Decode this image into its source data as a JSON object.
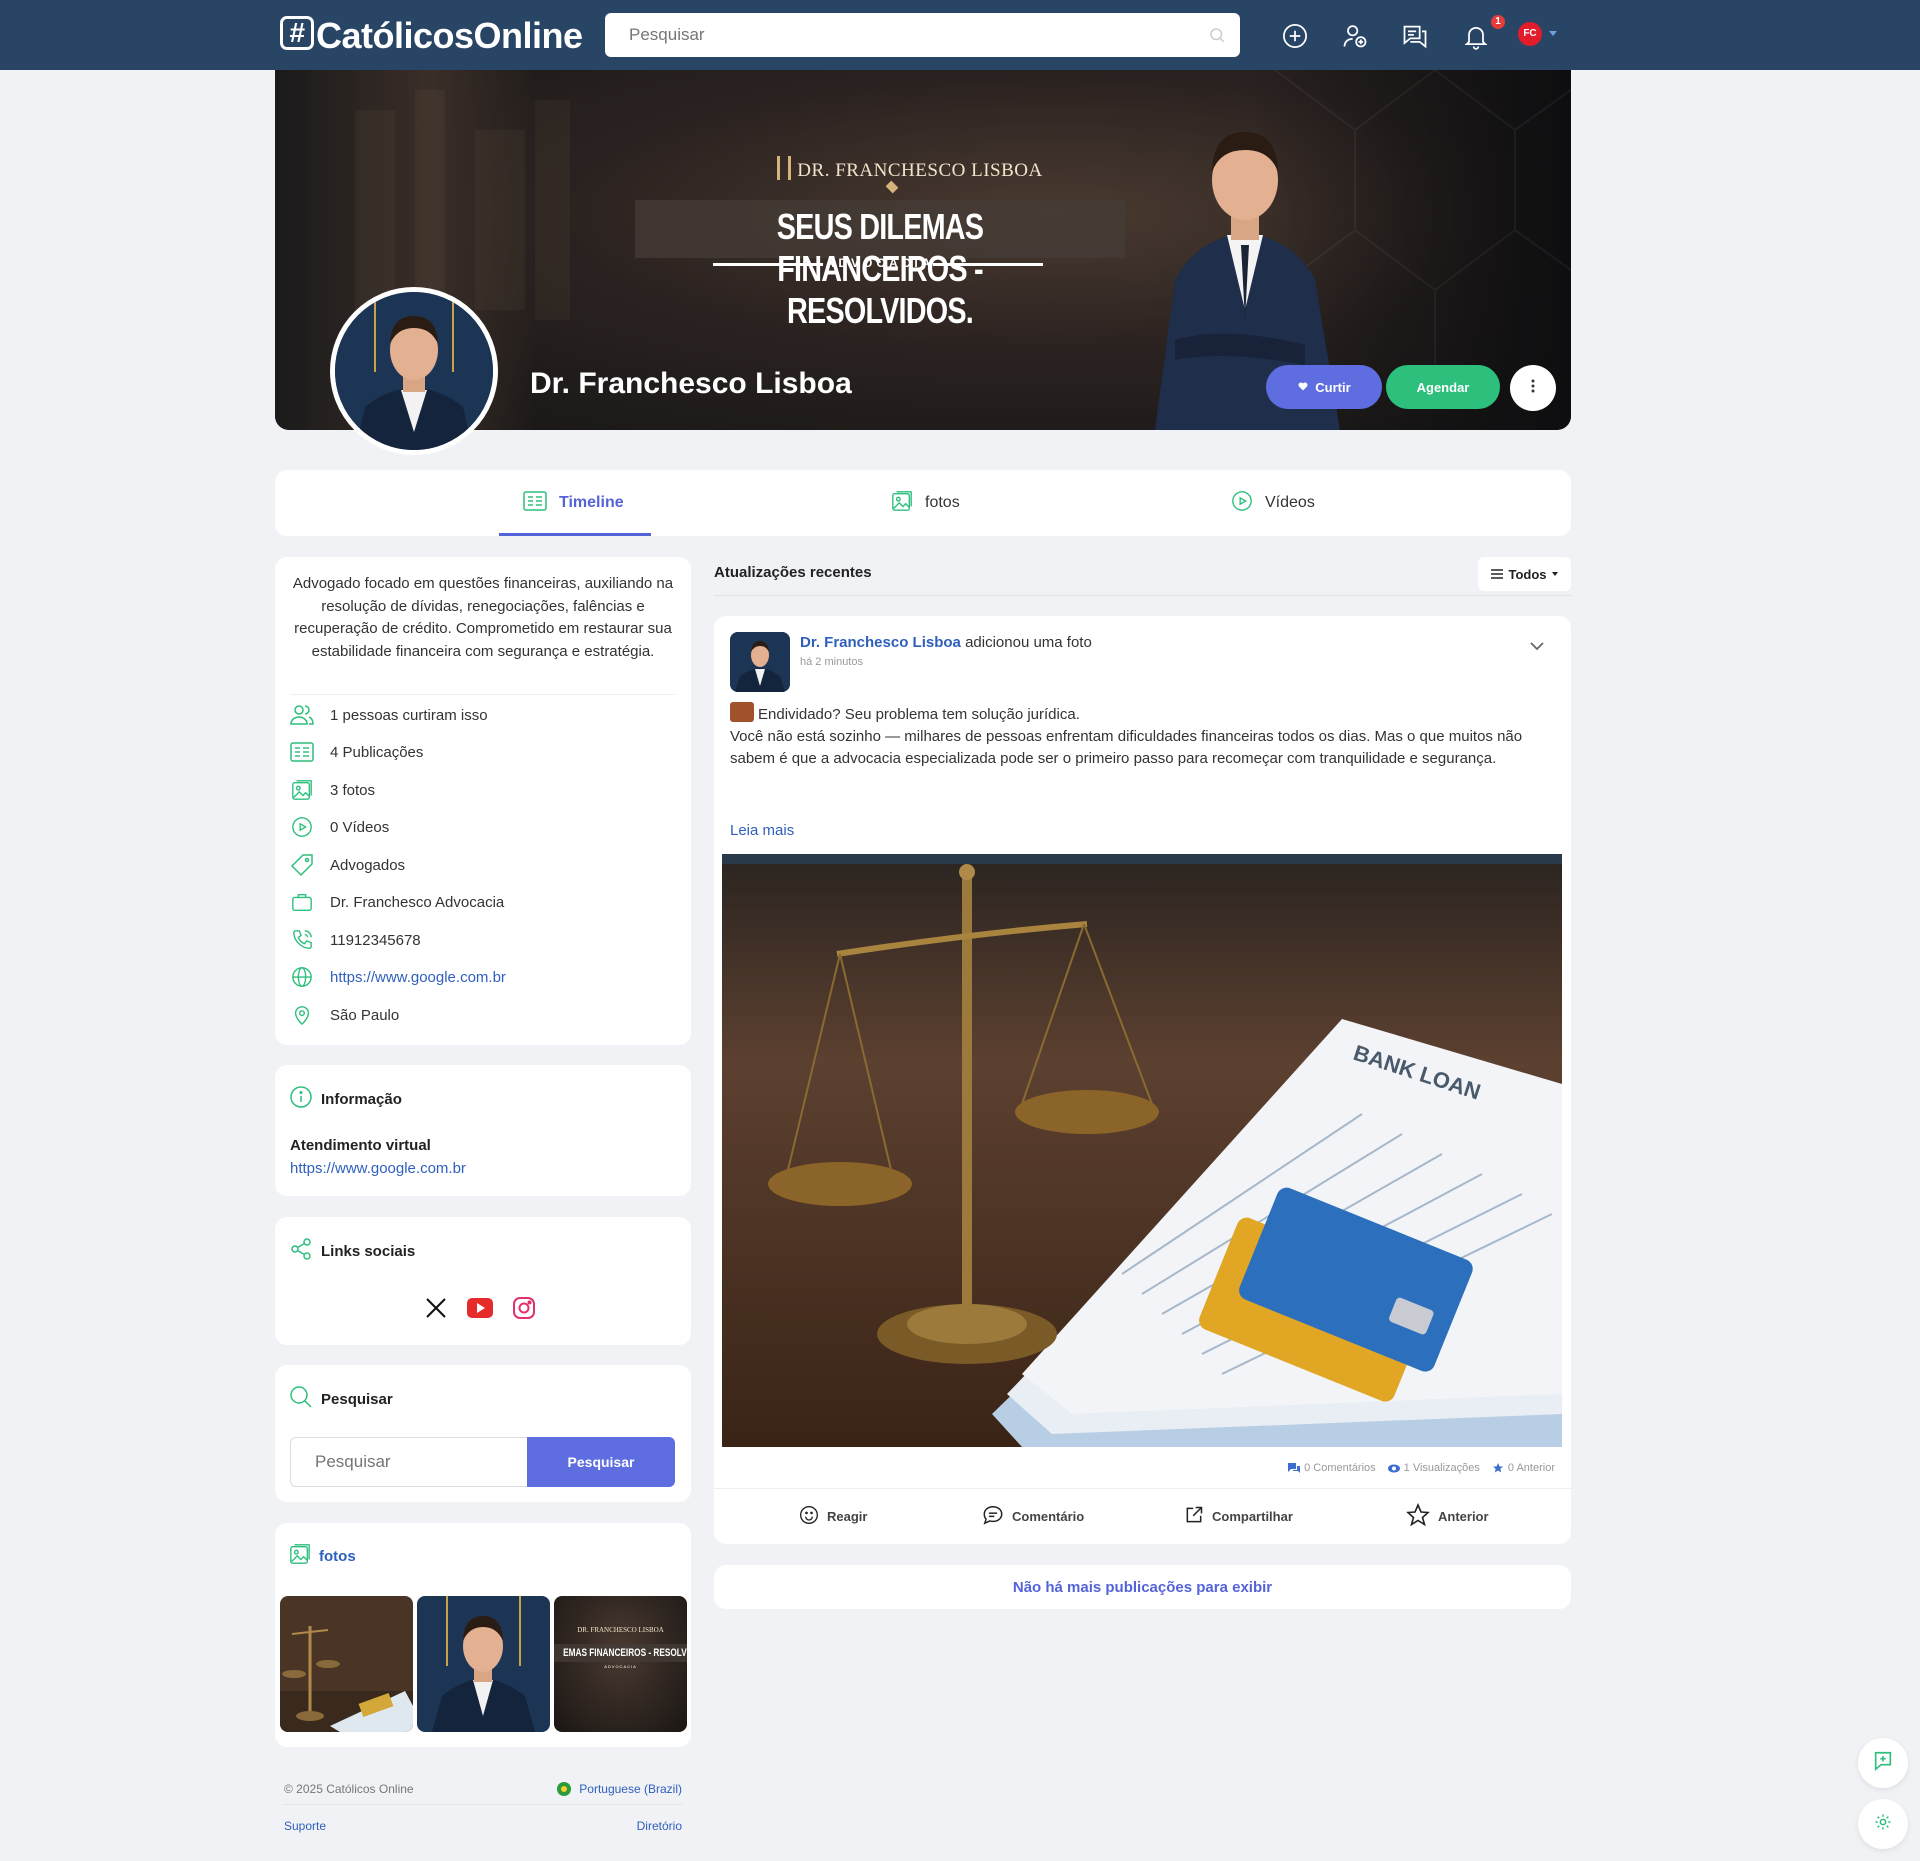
{
  "app": {
    "logo_text": "CatólicosOnline",
    "logo_hash": "#",
    "colors": {
      "topbar": "#294565",
      "accent": "#5e6de0",
      "green": "#2dbf7c",
      "link": "#2f5fbd"
    }
  },
  "header": {
    "search_placeholder": "Pesquisar",
    "notification_count": "1",
    "user_initials": "FC",
    "icons": [
      "search-icon",
      "add-circle-icon",
      "user-add-icon",
      "messages-icon",
      "bell-icon",
      "avatar",
      "chevron-down-icon"
    ]
  },
  "cover": {
    "brand": "DR. FRANCHESCO LISBOA",
    "headline": "SEUS DILEMAS FINANCEIROS - RESOLVIDOS.",
    "subline": "ADVOCACIA"
  },
  "profile": {
    "name": "Dr. Franchesco Lisboa",
    "like_label": "Curtir",
    "schedule_label": "Agendar"
  },
  "tabs": [
    {
      "label": "Timeline",
      "icon": "timeline-icon",
      "active": true
    },
    {
      "label": "fotos",
      "icon": "photos-icon",
      "active": false
    },
    {
      "label": "Vídeos",
      "icon": "video-icon",
      "active": false
    }
  ],
  "about": {
    "description": "Advogado focado em questões financeiras, auxiliando na resolução de dívidas, renegociações, falências e recuperação de crédito. Comprometido em restaurar sua estabilidade financeira com segurança e estratégia.",
    "rows": [
      {
        "icon": "users-icon",
        "text": "1 pessoas curtiram isso"
      },
      {
        "icon": "posts-icon",
        "text": "4 Publicações"
      },
      {
        "icon": "photos-icon",
        "text": "3 fotos"
      },
      {
        "icon": "video-icon",
        "text": "0 Vídeos"
      },
      {
        "icon": "tag-icon",
        "text": "Advogados"
      },
      {
        "icon": "briefcase-icon",
        "text": "Dr. Franchesco Advocacia"
      },
      {
        "icon": "phone-icon",
        "text": "11912345678"
      },
      {
        "icon": "globe-icon",
        "text": "https://www.google.com.br"
      },
      {
        "icon": "location-icon",
        "text": "São Paulo"
      }
    ]
  },
  "information": {
    "title": "Informação",
    "label": "Atendimento virtual",
    "link": "https://www.google.com.br"
  },
  "social": {
    "title": "Links sociais",
    "icons": [
      "x-icon",
      "youtube-icon",
      "instagram-icon"
    ]
  },
  "page_search": {
    "title": "Pesquisar",
    "placeholder": "Pesquisar",
    "button": "Pesquisar"
  },
  "photos": {
    "title": "fotos",
    "thumb_caption_brand": "DR. FRANCHESCO LISBOA",
    "thumb_caption_headline": "EMAS FINANCEIROS - RESOLVIDOS",
    "thumb_caption_sub": "ADVOCACIA"
  },
  "footer": {
    "copyright": "© 2025 Católicos Online",
    "language": "Portuguese (Brazil)",
    "support": "Suporte",
    "directory": "Diretório"
  },
  "feed": {
    "title": "Atualizações recentes",
    "filter": "Todos",
    "no_more": "Não há mais publicações para exibir"
  },
  "post": {
    "author": "Dr. Franchesco Lisboa",
    "action": "adicionou uma foto",
    "time": "há 2 minutos",
    "headline": "Endividado? Seu problema tem solução jurídica.",
    "body": "Você não está sozinho — milhares de pessoas enfrentam dificuldades financeiras todos os dias. Mas o que muitos não sabem é que a advocacia especializada pode ser o primeiro passo para recomeçar com tranquilidade e segurança.",
    "read_more": "Leia mais",
    "image_text": "BANK LOAN",
    "stats": {
      "comments": "0 Comentários",
      "views": "1 Visualizações",
      "previous": "0 Anterior"
    },
    "actions": {
      "react": "Reagir",
      "comment": "Comentário",
      "share": "Compartilhar",
      "previous": "Anterior"
    }
  }
}
